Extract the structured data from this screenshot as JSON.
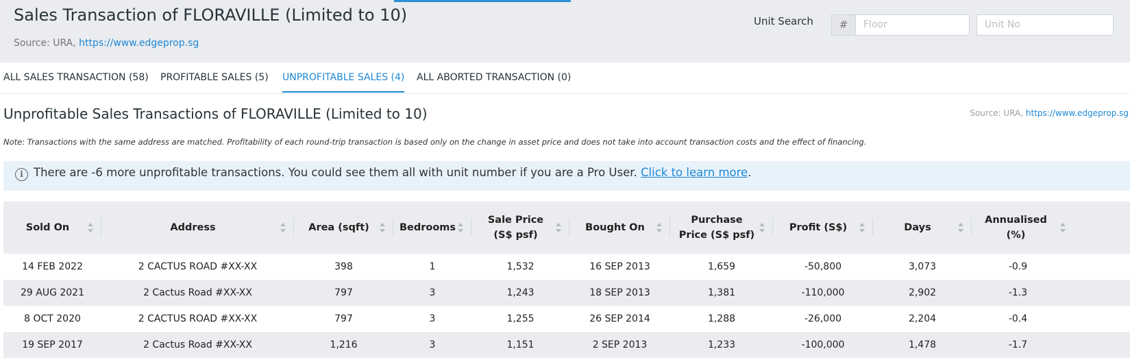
{
  "header": {
    "title": "Sales Transaction of FLORAVILLE (Limited to 10)",
    "source_prefix": "Source: URA,",
    "source_link": "https://www.edgeprop.sg",
    "unit_search_label": "Unit Search",
    "floor_prefix": "#",
    "floor_placeholder": "Floor",
    "unit_placeholder": "Unit No"
  },
  "tabs": [
    {
      "label": "ALL SALES TRANSACTION (58)",
      "active": false
    },
    {
      "label": "PROFITABLE SALES (5)",
      "active": false
    },
    {
      "label": "UNPROFITABLE SALES (4)",
      "active": true
    },
    {
      "label": "ALL ABORTED TRANSACTION (0)",
      "active": false
    }
  ],
  "section": {
    "title": "Unprofitable Sales Transactions of FLORAVILLE (Limited to 10)",
    "source_prefix": "Source: URA,",
    "source_link": "https://www.edgeprop.sg",
    "note": "Note: Transactions with the same address are matched. Profitability of each round-trip transaction is based only on the change in asset price and does not take into account transaction costs and the effect of financing."
  },
  "info": {
    "icon": "info-icon",
    "message": "There are -6 more unprofitable transactions. You could see them all with unit number if you are a Pro User.",
    "link": "Click to learn more",
    "suffix": "."
  },
  "table": {
    "columns": [
      {
        "label": "Sold On"
      },
      {
        "label": "Address"
      },
      {
        "label": "Area (sqft)"
      },
      {
        "label": "Bedrooms"
      },
      {
        "label": "Sale Price (S$ psf)"
      },
      {
        "label": "Bought On"
      },
      {
        "label": "Purchase Price (S$ psf)"
      },
      {
        "label": "Profit (S$)"
      },
      {
        "label": "Days"
      },
      {
        "label": "Annualised (%)"
      }
    ],
    "rows": [
      [
        "14 FEB 2022",
        "2 CACTUS ROAD #XX-XX",
        "398",
        "1",
        "1,532",
        "16 SEP 2013",
        "1,659",
        "-50,800",
        "3,073",
        "-0.9"
      ],
      [
        "29 AUG 2021",
        "2 Cactus Road #XX-XX",
        "797",
        "3",
        "1,243",
        "18 SEP 2013",
        "1,381",
        "-110,000",
        "2,902",
        "-1.3"
      ],
      [
        "8 OCT 2020",
        "2 CACTUS ROAD #XX-XX",
        "797",
        "3",
        "1,255",
        "26 SEP 2014",
        "1,288",
        "-26,000",
        "2,204",
        "-0.4"
      ],
      [
        "19 SEP 2017",
        "2 Cactus Road #XX-XX",
        "1,216",
        "3",
        "1,151",
        "2 SEP 2013",
        "1,233",
        "-100,000",
        "1,478",
        "-1.7"
      ]
    ]
  },
  "colors": {
    "accent": "#1e88d6",
    "header_bg": "#eaecef",
    "info_bg": "#e8f2fb"
  }
}
